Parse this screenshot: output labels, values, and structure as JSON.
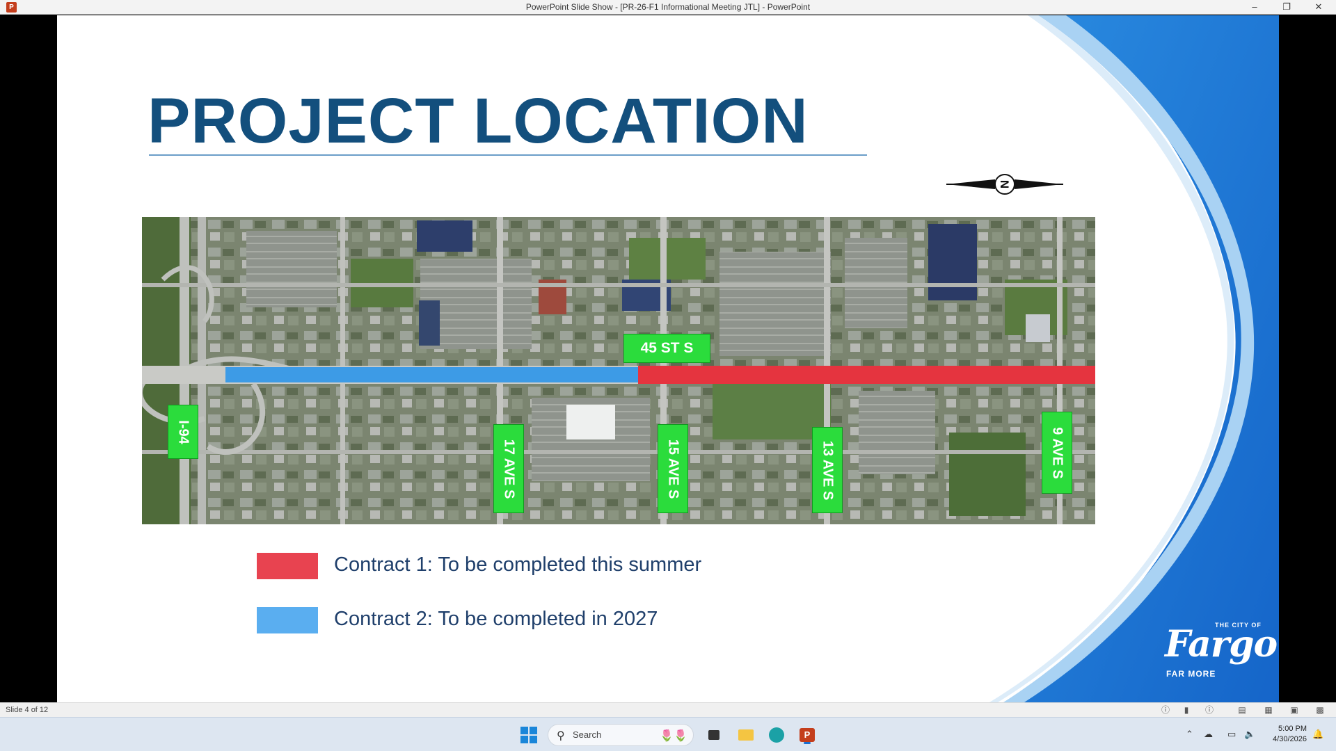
{
  "window": {
    "title": "PowerPoint Slide Show - [PR-26-F1 Informational Meeting JTL] - PowerPoint",
    "minimize_icon": "minimize-icon",
    "restore_icon": "restore-icon",
    "close_icon": "close-icon"
  },
  "slide": {
    "title": "PROJECT LOCATION",
    "compass_icon": "north-arrow-icon",
    "compass_letter": "N",
    "map": {
      "labels": {
        "street_45": "45 ST S",
        "i94": "I-94",
        "ave_17": "17 AVE S",
        "ave_15": "15 AVE S",
        "ave_13": "13 AVE S",
        "ave_9": "9 AVE S"
      },
      "segments": {
        "contract2_color": "#3d9be6",
        "contract1_color": "#e5343f"
      }
    },
    "legend": [
      {
        "color": "#e84350",
        "text": "Contract 1: To be completed this summer"
      },
      {
        "color": "#5aaef0",
        "text": "Contract 2: To be completed in 2027"
      }
    ],
    "logo": {
      "small": "THE CITY OF",
      "main": "Fargo",
      "tagline": "FAR MORE"
    }
  },
  "statusbar": {
    "slide_counter": "Slide 4 of 12"
  },
  "taskbar": {
    "search_placeholder": "Search",
    "time": "5:00 PM",
    "date": "4/30/2026"
  },
  "colors": {
    "title": "#134f7d",
    "accent_blue": "#1e7fd8",
    "label_green": "#2bdc3c"
  }
}
